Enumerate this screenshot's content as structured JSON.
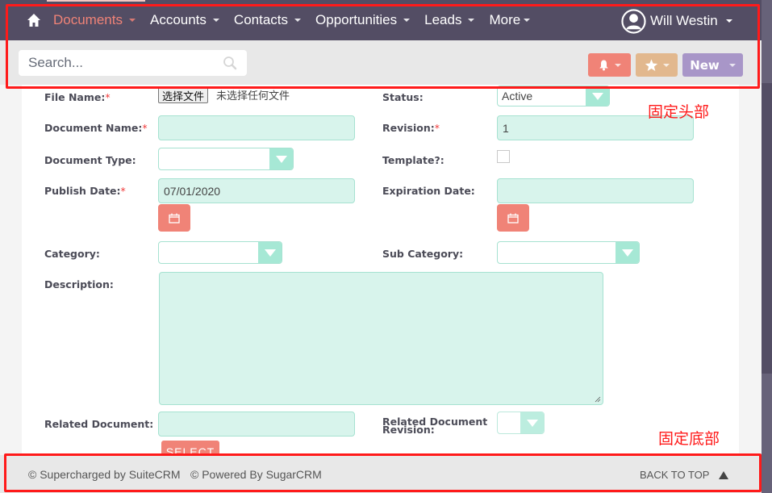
{
  "nav": {
    "home_icon": "home-icon",
    "items": [
      {
        "label": "Documents",
        "active": true
      },
      {
        "label": "Accounts",
        "active": false
      },
      {
        "label": "Contacts",
        "active": false
      },
      {
        "label": "Opportunities",
        "active": false
      },
      {
        "label": "Leads",
        "active": false
      },
      {
        "label": "More",
        "active": false
      }
    ],
    "user_name": "Will Westin"
  },
  "toolbar": {
    "search_placeholder": "Search...",
    "alerts_icon": "bell-icon",
    "favorites_icon": "star-icon",
    "new_label": "New"
  },
  "form": {
    "file_name": {
      "label": "File Name:",
      "required": "*",
      "button": "选择文件",
      "status": "未选择任何文件"
    },
    "status": {
      "label": "Status:",
      "value": "Active"
    },
    "document_name": {
      "label": "Document Name:",
      "required": "*",
      "value": ""
    },
    "revision": {
      "label": "Revision:",
      "required": "*",
      "value": "1"
    },
    "document_type": {
      "label": "Document Type:",
      "value": ""
    },
    "template": {
      "label": "Template?:",
      "checked": false
    },
    "publish_date": {
      "label": "Publish Date:",
      "required": "*",
      "value": "07/01/2020"
    },
    "expiration_date": {
      "label": "Expiration Date:",
      "value": ""
    },
    "category": {
      "label": "Category:",
      "value": ""
    },
    "sub_category": {
      "label": "Sub Category:",
      "value": ""
    },
    "description": {
      "label": "Description:",
      "value": ""
    },
    "related_document": {
      "label": "Related Document:",
      "value": "",
      "select_button": "SELECT"
    },
    "related_document_revision": {
      "label_line1": "Related Document",
      "label_line2": "Revision:",
      "value": ""
    }
  },
  "footer": {
    "suitecrm": "© Supercharged by SuiteCRM",
    "sugarcrm": "© Powered By SugarCRM",
    "back_to_top": "BACK TO TOP"
  },
  "annotations": {
    "fixed_header": "固定头部",
    "fixed_footer": "固定底部"
  },
  "colors": {
    "nav_bg": "#534d64",
    "active_nav": "#f08377",
    "input_bg": "#d8f4ec",
    "input_border": "#a6e2d1",
    "alerts_btn": "#f08377",
    "favorites_btn": "#e2b88e",
    "new_btn": "#a896c8",
    "annotation": "#ff1a1a"
  }
}
